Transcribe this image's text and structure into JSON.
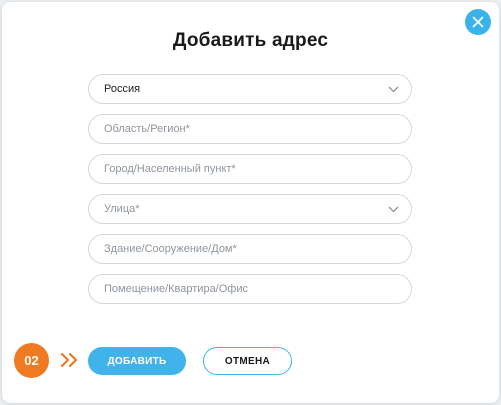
{
  "dialog": {
    "title": "Добавить адрес",
    "close_icon": "close-icon"
  },
  "form": {
    "country": {
      "value": "Россия",
      "icon": "chevron-down-icon"
    },
    "region": {
      "placeholder": "Область/Регион*"
    },
    "city": {
      "placeholder": "Город/Населенный пункт*"
    },
    "street": {
      "placeholder": "Улица*",
      "icon": "chevron-down-icon"
    },
    "building": {
      "placeholder": "Здание/Сооружение/Дом*"
    },
    "room": {
      "placeholder": "Помещение/Квартира/Офис"
    }
  },
  "tutorial": {
    "step": "02",
    "arrow_icon": "double-chevron-right-icon"
  },
  "buttons": {
    "add": "ДОБАВИТЬ",
    "cancel": "ОТМЕНА"
  },
  "colors": {
    "accent": "#40b3ea",
    "step_badge": "#ef7a22"
  }
}
